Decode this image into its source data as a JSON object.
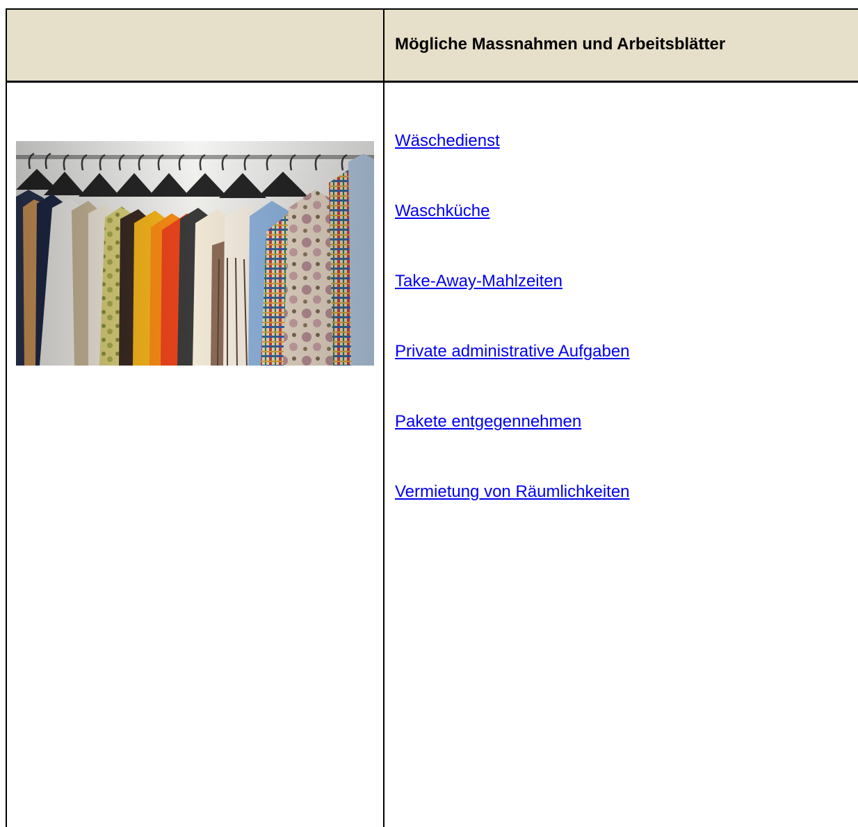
{
  "table": {
    "header": {
      "left": "",
      "right": "Mögliche Massnahmen und Arbeitsblätter"
    },
    "image_icon": "clothes-rack-photo",
    "links": [
      {
        "label": "Wäschedienst"
      },
      {
        "label": "Waschküche"
      },
      {
        "label": "Take-Away-Mahlzeiten"
      },
      {
        "label": "Private administrative Aufgaben"
      },
      {
        "label": "Pakete entgegennehmen"
      },
      {
        "label": "Vermietung von Räumlichkeiten"
      }
    ]
  },
  "colors": {
    "header_background": "#e6dfc9",
    "link": "#0000ee",
    "border": "#000000"
  }
}
